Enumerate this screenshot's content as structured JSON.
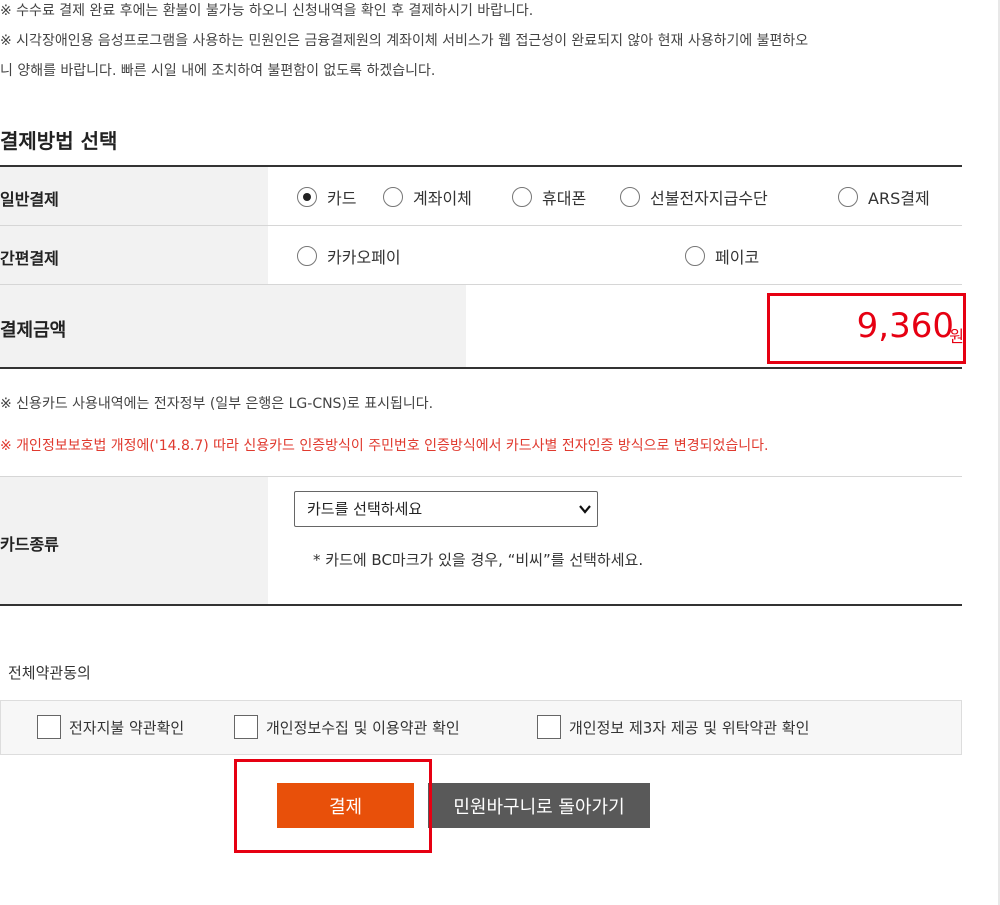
{
  "notices": {
    "line1": "※ 수수료 결제 완료 후에는 환불이 불가능 하오니 신청내역을 확인 후 결제하시기 바랍니다.",
    "line2": "※ 시각장애인용 음성프로그램을 사용하는 민원인은 금융결제원의 계좌이체 서비스가 웹 접근성이 완료되지 않아 현재 사용하기에 불편하오",
    "line3": "니 양해를 바랍니다. 빠른 시일 내에 조치하여 불편함이 없도록 하겠습니다."
  },
  "section_title": "결제방법 선택",
  "general_payment": {
    "label": "일반결제",
    "options": [
      "카드",
      "계좌이체",
      "휴대폰",
      "선불전자지급수단",
      "ARS결제"
    ],
    "selected": "카드"
  },
  "simple_payment": {
    "label": "간편결제",
    "options": [
      "카카오페이",
      "페이코"
    ]
  },
  "amount": {
    "label": "결제금액",
    "value": "9,360",
    "unit": "원"
  },
  "card_notes": {
    "line1": "※ 신용카드 사용내역에는 전자정부 (일부 은행은 LG-CNS)로 표시됩니다.",
    "line2": "※ 개인정보보호법 개정에('14.8.7) 따라 신용카드 인증방식이 주민번호 인증방식에서 카드사별 전자인증 방식으로 변경되었습니다."
  },
  "card_type": {
    "label": "카드종류",
    "select_value": "카드를 선택하세요",
    "hint": "* 카드에 BC마크가 있을 경우, “비씨”를 선택하세요."
  },
  "agreements": {
    "all_label": "전체약관동의",
    "items": [
      "전자지불 약관확인",
      "개인정보수집 및 이용약관 확인",
      "개인정보 제3자 제공 및 위탁약관 확인"
    ]
  },
  "buttons": {
    "pay": "결제",
    "back": "민원바구니로 돌아가기"
  },
  "colors": {
    "accent": "#e8500a",
    "highlight": "#e60012",
    "secondary_button": "#595959"
  }
}
